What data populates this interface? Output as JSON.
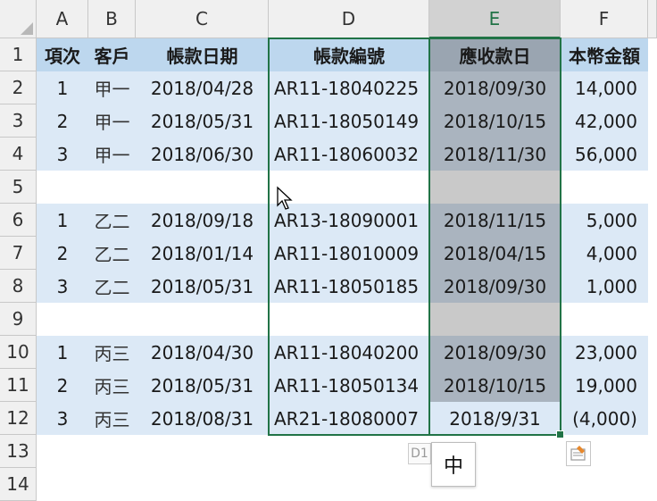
{
  "columns": [
    "A",
    "B",
    "C",
    "D",
    "E",
    "F"
  ],
  "rows": [
    "1",
    "2",
    "3",
    "4",
    "5",
    "6",
    "7",
    "8",
    "9",
    "10",
    "11",
    "12",
    "13",
    "14"
  ],
  "header_row": [
    "項次",
    "客戶",
    "帳款日期",
    "帳款編號",
    "應收款日",
    "本幣金額"
  ],
  "data_rows": [
    [
      "1",
      "甲一",
      "2018/04/28",
      "AR11-18040225",
      "2018/09/30",
      "14,000"
    ],
    [
      "2",
      "甲一",
      "2018/05/31",
      "AR11-18050149",
      "2018/10/15",
      "42,000"
    ],
    [
      "3",
      "甲一",
      "2018/06/30",
      "AR11-18060032",
      "2018/11/30",
      "56,000"
    ],
    [
      "",
      "",
      "",
      "",
      "",
      ""
    ],
    [
      "1",
      "乙二",
      "2018/09/18",
      "AR13-18090001",
      "2018/11/15",
      "5,000"
    ],
    [
      "2",
      "乙二",
      "2018/01/14",
      "AR11-18010009",
      "2018/04/15",
      "4,000"
    ],
    [
      "3",
      "乙二",
      "2018/05/31",
      "AR11-18050185",
      "2018/09/30",
      "1,000"
    ],
    [
      "",
      "",
      "",
      "",
      "",
      ""
    ],
    [
      "1",
      "丙三",
      "2018/04/30",
      "AR11-18040200",
      "2018/09/30",
      "23,000"
    ],
    [
      "2",
      "丙三",
      "2018/05/31",
      "AR11-18050134",
      "2018/10/15",
      "19,000"
    ],
    [
      "3",
      "丙三",
      "2018/08/31",
      "AR21-18080007",
      "2018/9/31",
      "(4,000)"
    ]
  ],
  "selected_column": "E",
  "selection_range_label": "D1",
  "ime_mode": "中",
  "colors": {
    "selection": "#217346",
    "band": "#dce9f6",
    "title_band": "#bdd7ee",
    "selected_col_fill": "#aab4bf"
  },
  "icons": {
    "pointer": "mouse-pointer-icon",
    "quick_analysis": "quick-analysis-icon"
  }
}
